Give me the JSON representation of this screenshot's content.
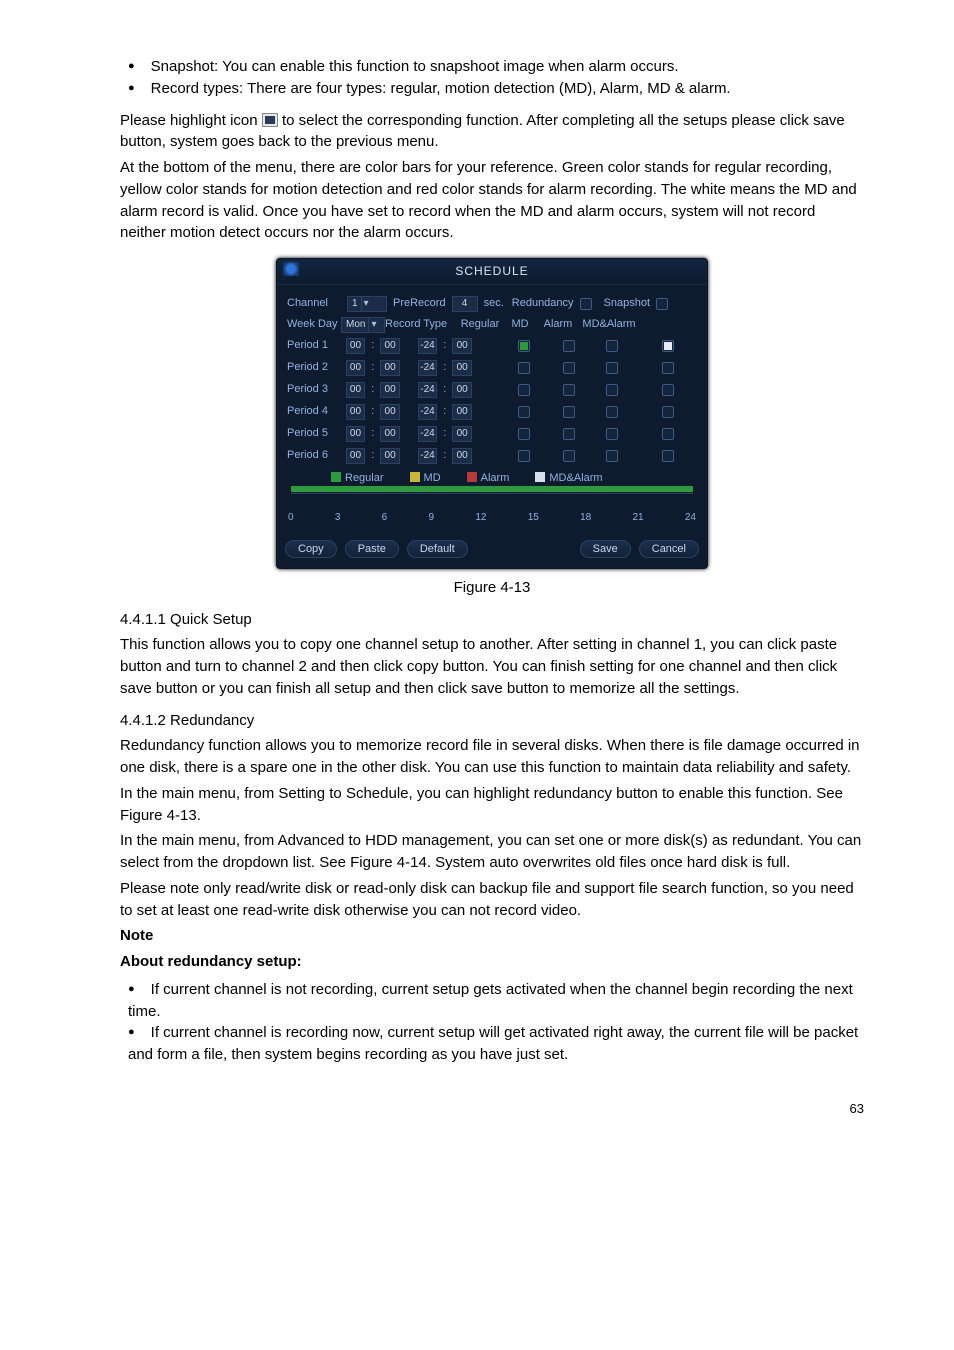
{
  "bullets_top": [
    "Snapshot: You can enable this function to snapshoot image when alarm occurs.",
    "Record types: There are four types: regular, motion detection (MD), Alarm, MD & alarm."
  ],
  "para1_pre": "Please highlight icon ",
  "para1_post": " to select the corresponding function. After completing all the setups please click save button, system goes back to the previous menu.",
  "para2": "At the bottom of the menu, there are color bars for your reference. Green color stands for regular recording, yellow color stands for motion detection and red color stands for alarm recording. The white means the MD and alarm record is valid. Once you have set to record when the MD and alarm occurs, system will not record neither motion detect occurs nor the alarm occurs.",
  "figure_caption": "Figure 4-13",
  "sec1_title": "4.4.1.1  Quick Setup",
  "sec1_body": "This function allows you to copy one channel setup to another. After setting in channel 1, you can click paste button and turn to channel 2 and then click copy button. You can finish setting for one channel and then click save button or you can finish all setup and then click save button to memorize all the settings.",
  "sec2_title": "4.4.1.2  Redundancy",
  "sec2_b1": "Redundancy function allows you to memorize record file in several disks. When there is file damage occurred in one disk, there is a spare one in the other disk. You can use this function to maintain data reliability and safety.",
  "sec2_b2": "In the main menu, from Setting to Schedule, you can highlight redundancy button to enable this function. See Figure 4-13.",
  "sec2_b3": "In the main menu, from Advanced to HDD management, you can set one or more disk(s) as redundant. You can select from the dropdown list. See Figure 4-14. System auto overwrites old files once hard disk is full.",
  "sec2_b4": "Please note only read/write disk or read-only disk can backup file and support file search function, so you need to set at least one read-write disk otherwise you can not record video.",
  "note_label": "Note",
  "about_label": "About redundancy setup:",
  "bullets_bottom": [
    "If current channel is not recording, current setup gets activated when the channel begin recording the next time.",
    "If current channel is recording now, current setup will get activated right away, the current file will be packet and form a file, then system begins recording as you have just set."
  ],
  "page_number": "63",
  "dlg": {
    "title": "SCHEDULE",
    "labels": {
      "channel": "Channel",
      "weekday": "Week Day",
      "prerecord": "PreRecord",
      "sec": "sec.",
      "redundancy": "Redundancy",
      "snapshot": "Snapshot",
      "recordtype": "Record Type",
      "periods": [
        "Period 1",
        "Period 2",
        "Period 3",
        "Period 4",
        "Period 5",
        "Period 6"
      ]
    },
    "channel_value": "1",
    "weekday_value": "Mon",
    "prerecord_value": "4",
    "headers": {
      "regular": "Regular",
      "md": "MD",
      "alarm": "Alarm",
      "mdalarm": "MD&Alarm"
    },
    "period_values": [
      {
        "s1": "00",
        "s2": "00",
        "e1": "24",
        "e2": "00",
        "reg": "green",
        "md": "off",
        "al": "off",
        "ma": "white"
      },
      {
        "s1": "00",
        "s2": "00",
        "e1": "24",
        "e2": "00",
        "reg": "off",
        "md": "off",
        "al": "off",
        "ma": "off"
      },
      {
        "s1": "00",
        "s2": "00",
        "e1": "24",
        "e2": "00",
        "reg": "off",
        "md": "off",
        "al": "off",
        "ma": "off"
      },
      {
        "s1": "00",
        "s2": "00",
        "e1": "24",
        "e2": "00",
        "reg": "off",
        "md": "off",
        "al": "off",
        "ma": "off"
      },
      {
        "s1": "00",
        "s2": "00",
        "e1": "24",
        "e2": "00",
        "reg": "off",
        "md": "off",
        "al": "off",
        "ma": "off"
      },
      {
        "s1": "00",
        "s2": "00",
        "e1": "24",
        "e2": "00",
        "reg": "off",
        "md": "off",
        "al": "off",
        "ma": "off"
      }
    ],
    "legend": {
      "regular": "Regular",
      "md": "MD",
      "alarm": "Alarm",
      "mdalarm": "MD&Alarm"
    },
    "ticks": [
      "0",
      "3",
      "6",
      "9",
      "12",
      "15",
      "18",
      "21",
      "24"
    ],
    "buttons": {
      "copy": "Copy",
      "paste": "Paste",
      "default": "Default",
      "save": "Save",
      "cancel": "Cancel"
    }
  }
}
